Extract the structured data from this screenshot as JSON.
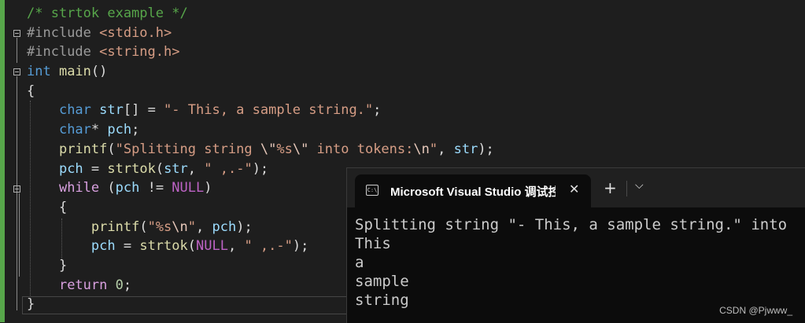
{
  "editor": {
    "lines": [
      [
        {
          "t": "/* strtok example */",
          "c": "c-comment"
        }
      ],
      [
        {
          "t": "#include ",
          "c": "c-pre"
        },
        {
          "t": "<stdio.h>",
          "c": "c-str"
        }
      ],
      [
        {
          "t": "#include ",
          "c": "c-pre"
        },
        {
          "t": "<string.h>",
          "c": "c-str"
        }
      ],
      [
        {
          "t": "int ",
          "c": "c-kw"
        },
        {
          "t": "main",
          "c": "c-fn"
        },
        {
          "t": "()",
          "c": "c-punc"
        }
      ],
      [
        {
          "t": "{",
          "c": "c-punc"
        }
      ],
      [
        {
          "t": "    ",
          "c": "c-punc"
        },
        {
          "t": "char ",
          "c": "c-kw"
        },
        {
          "t": "str",
          "c": "c-var"
        },
        {
          "t": "[] = ",
          "c": "c-punc"
        },
        {
          "t": "\"- This, a sample string.\"",
          "c": "c-str"
        },
        {
          "t": ";",
          "c": "c-punc"
        }
      ],
      [
        {
          "t": "    ",
          "c": "c-punc"
        },
        {
          "t": "char",
          "c": "c-kw"
        },
        {
          "t": "* ",
          "c": "c-punc"
        },
        {
          "t": "pch",
          "c": "c-var"
        },
        {
          "t": ";",
          "c": "c-punc"
        }
      ],
      [
        {
          "t": "    ",
          "c": "c-punc"
        },
        {
          "t": "printf",
          "c": "c-fn"
        },
        {
          "t": "(",
          "c": "c-punc"
        },
        {
          "t": "\"Splitting string ",
          "c": "c-str"
        },
        {
          "t": "\\\"",
          "c": "c-esc"
        },
        {
          "t": "%s",
          "c": "c-str"
        },
        {
          "t": "\\\"",
          "c": "c-esc"
        },
        {
          "t": " into tokens:",
          "c": "c-str"
        },
        {
          "t": "\\n",
          "c": "c-esc"
        },
        {
          "t": "\"",
          "c": "c-str"
        },
        {
          "t": ", ",
          "c": "c-punc"
        },
        {
          "t": "str",
          "c": "c-var"
        },
        {
          "t": ");",
          "c": "c-punc"
        }
      ],
      [
        {
          "t": "    ",
          "c": "c-punc"
        },
        {
          "t": "pch",
          "c": "c-var"
        },
        {
          "t": " = ",
          "c": "c-punc"
        },
        {
          "t": "strtok",
          "c": "c-fn"
        },
        {
          "t": "(",
          "c": "c-punc"
        },
        {
          "t": "str",
          "c": "c-var"
        },
        {
          "t": ", ",
          "c": "c-punc"
        },
        {
          "t": "\" ,.-\"",
          "c": "c-str"
        },
        {
          "t": ");",
          "c": "c-punc"
        }
      ],
      [
        {
          "t": "    ",
          "c": "c-punc"
        },
        {
          "t": "while",
          "c": "c-ctrl"
        },
        {
          "t": " (",
          "c": "c-punc"
        },
        {
          "t": "pch",
          "c": "c-var"
        },
        {
          "t": " != ",
          "c": "c-punc"
        },
        {
          "t": "NULL",
          "c": "c-macro"
        },
        {
          "t": ")",
          "c": "c-punc"
        }
      ],
      [
        {
          "t": "    {",
          "c": "c-punc"
        }
      ],
      [
        {
          "t": "        ",
          "c": "c-punc"
        },
        {
          "t": "printf",
          "c": "c-fn"
        },
        {
          "t": "(",
          "c": "c-punc"
        },
        {
          "t": "\"%s",
          "c": "c-str"
        },
        {
          "t": "\\n",
          "c": "c-esc"
        },
        {
          "t": "\"",
          "c": "c-str"
        },
        {
          "t": ", ",
          "c": "c-punc"
        },
        {
          "t": "pch",
          "c": "c-var"
        },
        {
          "t": ");",
          "c": "c-punc"
        }
      ],
      [
        {
          "t": "        ",
          "c": "c-punc"
        },
        {
          "t": "pch",
          "c": "c-var"
        },
        {
          "t": " = ",
          "c": "c-punc"
        },
        {
          "t": "strtok",
          "c": "c-fn"
        },
        {
          "t": "(",
          "c": "c-punc"
        },
        {
          "t": "NULL",
          "c": "c-macro"
        },
        {
          "t": ", ",
          "c": "c-punc"
        },
        {
          "t": "\" ,.-\"",
          "c": "c-str"
        },
        {
          "t": ");",
          "c": "c-punc"
        }
      ],
      [
        {
          "t": "    }",
          "c": "c-punc"
        }
      ],
      [
        {
          "t": "    ",
          "c": "c-punc"
        },
        {
          "t": "return ",
          "c": "c-ctrl"
        },
        {
          "t": "0",
          "c": "c-num"
        },
        {
          "t": ";",
          "c": "c-punc"
        }
      ],
      [
        {
          "t": "}",
          "c": "c-punc"
        }
      ]
    ]
  },
  "terminal": {
    "tab_icon": "C:\\",
    "tab_title": "Microsoft Visual Studio 调试控",
    "close_glyph": "✕",
    "new_tab_glyph": "+",
    "dropdown_glyph": "⌵",
    "icons": {
      "tab": "console-icon",
      "close": "close-icon",
      "new_tab": "plus-icon",
      "dropdown": "chevron-down-icon"
    },
    "output": "Splitting string \"- This, a sample string.\" into\nThis\na\nsample\nstring"
  },
  "watermark": "CSDN @Pjwww_",
  "colors": {
    "editor_bg": "#1e1e1e",
    "comment": "#57a64a",
    "keyword": "#569cd6",
    "control": "#d8a0df",
    "string": "#d69d85",
    "function": "#dcdcaa",
    "variable": "#9cdcfe",
    "terminal_bg": "#0c0c0c"
  }
}
